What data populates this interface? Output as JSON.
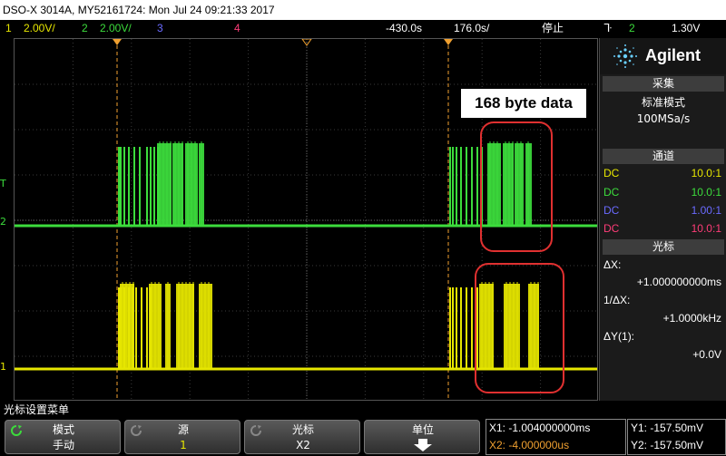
{
  "title": "DSO-X 3014A, MY52161724: Mon Jul 24 09:21:33 2017",
  "topbar": {
    "ch1_num": "1",
    "ch1_scale": "2.00V/",
    "ch2_num": "2",
    "ch2_scale": "2.00V/",
    "ch3_num": "3",
    "ch4_num": "4",
    "delay": "-430.0s",
    "timebase": "176.0s/",
    "run_state": "停止",
    "trig_src": "2",
    "trig_level": "1.30V"
  },
  "annotation": "168 byte data",
  "right_panel": {
    "logo": "Agilent",
    "acq_header": "采集",
    "acq_mode": "标准模式",
    "acq_rate": "100MSa/s",
    "chan_header": "通道",
    "channels": [
      {
        "coupling": "DC",
        "probe": "10.0:1",
        "color": "#e6e600"
      },
      {
        "coupling": "DC",
        "probe": "10.0:1",
        "color": "#3cdc3c"
      },
      {
        "coupling": "DC",
        "probe": "1.00:1",
        "color": "#6a6aff"
      },
      {
        "coupling": "DC",
        "probe": "10.0:1",
        "color": "#ff3c78"
      }
    ],
    "cursor_header": "光标",
    "dx_label": "ΔX:",
    "dx_value": "+1.000000000ms",
    "inv_dx_label": "1/ΔX:",
    "inv_dx_value": "+1.0000kHz",
    "dy_label": "ΔY(1):",
    "dy_value": "+0.0V"
  },
  "menu": {
    "title": "光标设置菜单",
    "keys": [
      {
        "top": "模式",
        "bottom": "手动"
      },
      {
        "top": "源",
        "bottom": "1"
      },
      {
        "top": "光标",
        "bottom": "X2"
      },
      {
        "top": "单位",
        "bottom": ""
      }
    ]
  },
  "readouts": {
    "x1": "X1: -1.004000000ms",
    "x2": "X2: -4.000000us",
    "y1": "Y1: -157.50mV",
    "y2": "Y2: -157.50mV"
  },
  "colors": {
    "ch1": "#e6e600",
    "ch2": "#3cdc3c",
    "cursor": "#f0a030",
    "highlight": "#e03030"
  }
}
